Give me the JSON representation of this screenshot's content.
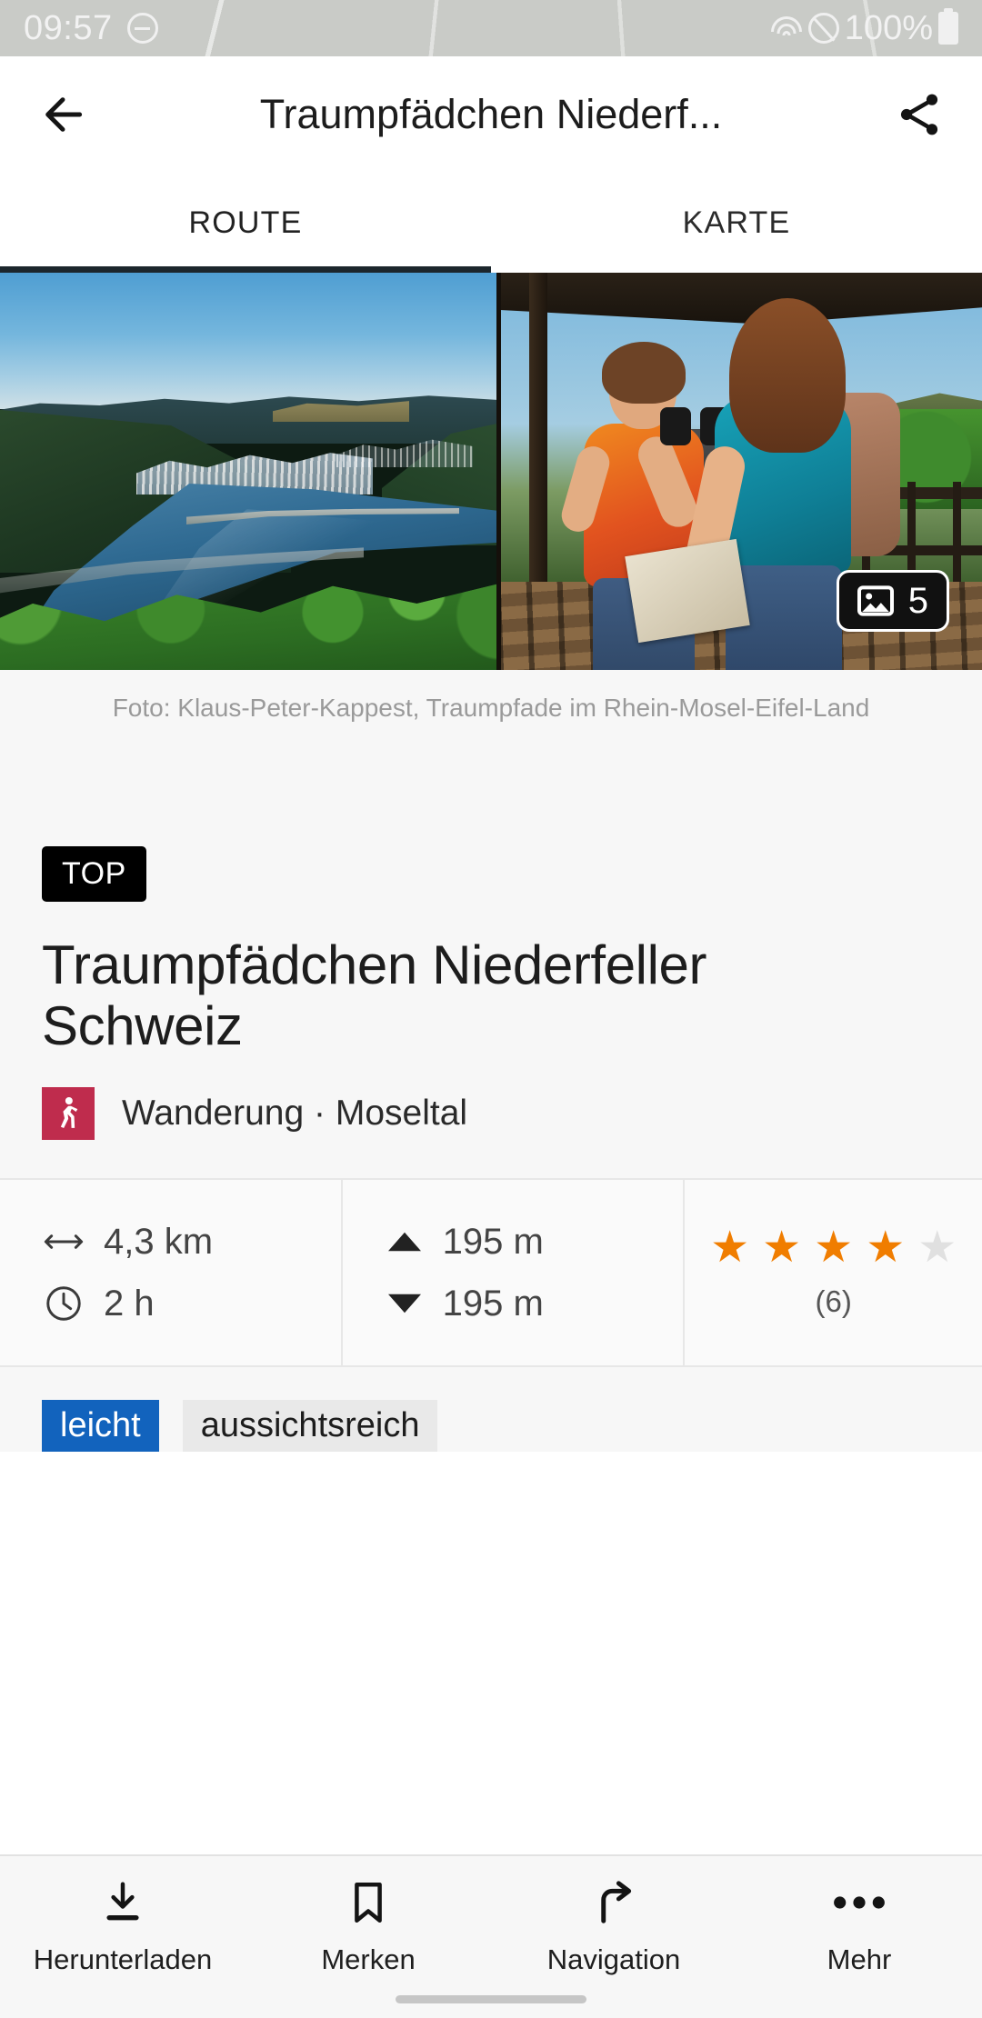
{
  "status_bar": {
    "time": "09:57",
    "battery_percent": "100%",
    "icons": [
      "dnd-icon",
      "wifi-icon",
      "no-sim-icon",
      "battery-icon"
    ]
  },
  "app_bar": {
    "back_icon": "arrow-left-icon",
    "title": "Traumpfädchen Niederf...",
    "share_icon": "share-icon"
  },
  "tabs": [
    {
      "label": "ROUTE",
      "active": true
    },
    {
      "label": "KARTE",
      "active": false
    }
  ],
  "hero": {
    "photo_badge": {
      "icon": "image-icon",
      "count": "5"
    },
    "caption": "Foto: Klaus-Peter-Kappest, Traumpfade im Rhein-Mosel-Eifel-Land"
  },
  "detail": {
    "top_badge": "TOP",
    "title": "Traumpfädchen Niederfeller Schweiz",
    "category_icon": "hiking-icon",
    "category": "Wanderung · Moseltal"
  },
  "stats": {
    "distance": {
      "icon": "distance-icon",
      "value": "4,3 km"
    },
    "duration": {
      "icon": "clock-icon",
      "value": "2 h"
    },
    "ascent": {
      "icon": "ascent-icon",
      "value": "195 m"
    },
    "descent": {
      "icon": "descent-icon",
      "value": "195 m"
    },
    "rating": {
      "filled": 4,
      "total": 5,
      "count": "(6)"
    }
  },
  "chips": [
    {
      "label": "leicht",
      "style": "primary"
    },
    {
      "label": "aussichtsreich",
      "style": "muted"
    }
  ],
  "bottom_bar": [
    {
      "label": "Herunterladen",
      "icon": "download-icon"
    },
    {
      "label": "Merken",
      "icon": "bookmark-icon"
    },
    {
      "label": "Navigation",
      "icon": "navigation-arrow-icon"
    },
    {
      "label": "Mehr",
      "icon": "more-dots-icon"
    }
  ],
  "colors": {
    "accent_blue": "#1263bd",
    "star_orange": "#F07D00",
    "star_grey": "#e0e0e0",
    "category_red": "#bf2c4d",
    "tab_indicator": "#1c262c"
  }
}
